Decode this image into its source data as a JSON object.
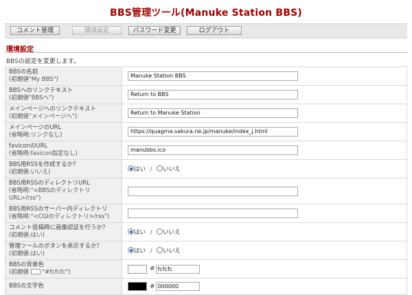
{
  "app": {
    "title": "BBS管理ツール(Manuke Station BBS)"
  },
  "nav": [
    {
      "label": "コメント管理",
      "disabled": false
    },
    {
      "label": "環境設定",
      "disabled": true
    },
    {
      "label": "パスワード変更",
      "disabled": false
    },
    {
      "label": "ログアウト",
      "disabled": false
    }
  ],
  "section": {
    "title": "環境設定",
    "description": "BBSの設定を変更します。"
  },
  "settings": {
    "bbs_name": {
      "label": "BBSの名前",
      "hint": "(初期値\"My BBS\")",
      "value": "Manuke Station BBS"
    },
    "bbs_link_text": {
      "label": "BBSへのリンクテキスト",
      "hint": "(初期値\"BBSへ\")",
      "value": "Return to BBS"
    },
    "main_link_text": {
      "label": "メインページへのリンクテキスト",
      "hint": "(初期値\"メインページへ\")",
      "value": "Return to Manuke Station"
    },
    "main_url": {
      "label": "メインページのURL",
      "hint": "(省略時:リンクなし)",
      "value": "https://quagma.sakura.ne.jp/manuke/index_j.html"
    },
    "favicon_url": {
      "label": "faviconのURL",
      "hint": "(省略時:favicon指定なし)",
      "value": "manubbs.ico"
    },
    "rss_create": {
      "label": "BBS用RSSを作成するか？",
      "hint": "(初期値:いいえ)",
      "yes": "はい",
      "no": "いいえ",
      "selected": "yes"
    },
    "rss_dir_url": {
      "label": "BBS用RSSのディレクトリURL",
      "hint": "(省略時:\"<BBSのディレクトリURL>/rss\")",
      "value": ""
    },
    "rss_server_dir": {
      "label": "BBS用RSSのサーバー内ディレクトリ",
      "hint": "(省略時:\"<CGIのディレクトリ>/rss\")",
      "value": ""
    },
    "image_auth": {
      "label": "コメント投稿時に画像認証を行うか？",
      "hint": "(初期値:はい)",
      "yes": "はい",
      "no": "いいえ",
      "selected": "yes"
    },
    "admin_button": {
      "label": "管理ツールのボタンを表示するか？",
      "hint": "(初期値:はい)",
      "yes": "はい",
      "no": "いいえ",
      "selected": "yes"
    },
    "bg_color": {
      "label": "BBSの背景色",
      "hint_prefix": "(初期値",
      "hint_suffix": "\"#fcfcfc\")",
      "hash": "#",
      "value": "fcfcfc",
      "swatch": "#fcfcfc"
    },
    "text_color": {
      "label": "BBSの文字色",
      "hash": "#",
      "value": "000000",
      "swatch": "#000000"
    }
  },
  "separator": "/"
}
